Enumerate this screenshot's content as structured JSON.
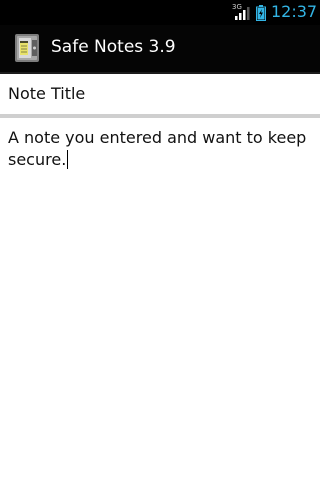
{
  "status_bar": {
    "network_type": "3G",
    "time": "12:37",
    "signal_icon": "signal-bars-icon",
    "battery_icon": "battery-charging-icon"
  },
  "action_bar": {
    "title": "Safe Notes 3.9",
    "app_icon": "safe-notes-app-icon"
  },
  "note": {
    "title_value": "Note Title",
    "body_value": "A note you entered and want to keep secure."
  },
  "colors": {
    "accent": "#33b5e5",
    "status_bar_bg": "#000000",
    "action_bar_bg": "#050505",
    "divider": "#cfcfcf"
  }
}
